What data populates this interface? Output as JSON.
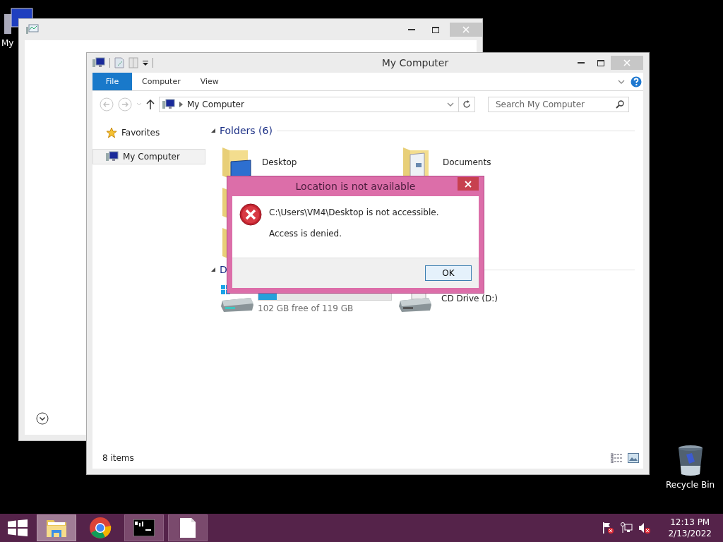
{
  "desktop_icons": [
    {
      "kind": "computer",
      "label": "My"
    },
    {
      "kind": "recycle-bin",
      "label": "Recycle Bin"
    }
  ],
  "explorer": {
    "title": "My Computer",
    "ribbon_tabs": [
      {
        "label": "File",
        "selected": true
      },
      {
        "label": "Computer",
        "selected": false
      },
      {
        "label": "View",
        "selected": false
      }
    ],
    "address": "My Computer",
    "search": {
      "placeholder": "Search My Computer"
    },
    "nav": [
      {
        "kind": "favorites",
        "label": "Favorites",
        "selected": false
      },
      {
        "kind": "computer",
        "label": "My Computer",
        "selected": true
      }
    ],
    "folders": {
      "title": "Folders (6)",
      "items": [
        {
          "kind": "desktop",
          "label": "Desktop"
        },
        {
          "kind": "documents",
          "label": "Documents"
        },
        {
          "kind": "folder"
        },
        {
          "kind": "folder"
        }
      ]
    },
    "drives": {
      "title": "D",
      "items": [
        {
          "kind": "local-disk",
          "level": 0.14,
          "free": "102 GB free of 119 GB"
        },
        {
          "kind": "cd-drive",
          "label": "CD Drive (D:)"
        }
      ]
    },
    "status": "8 items"
  },
  "dialog": {
    "title": "Location is not available",
    "message": "C:\\Users\\VM4\\Desktop is not accessible.",
    "detail": "Access is denied.",
    "button": "OK"
  },
  "taskbar": {
    "apps": [
      {
        "kind": "explorer",
        "running": true,
        "selected": true
      },
      {
        "kind": "chrome",
        "running": false,
        "selected": false
      },
      {
        "kind": "console",
        "running": true,
        "selected": false
      },
      {
        "kind": "document",
        "running": true,
        "selected": false
      }
    ],
    "time": "12:13 PM",
    "date": "2/13/2022"
  }
}
